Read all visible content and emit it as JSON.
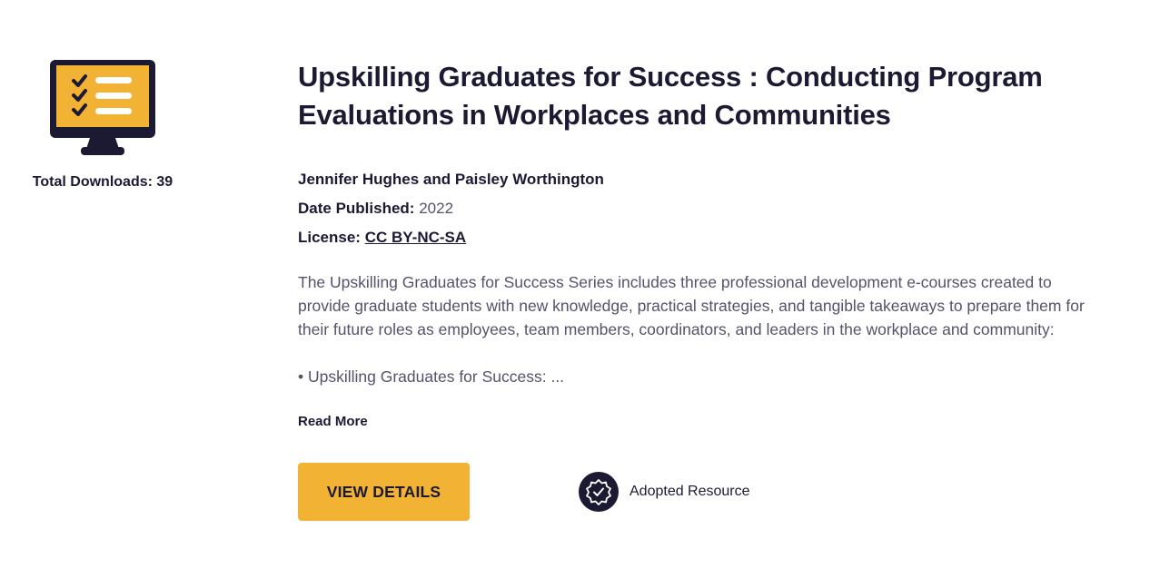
{
  "sidebar": {
    "icon": "monitor-checklist-icon",
    "downloads_label": "Total Downloads: 39"
  },
  "resource": {
    "title": "Upskilling Graduates for Success : Conducting Program Evaluations in Workplaces and Communities",
    "authors": "Jennifer Hughes and Paisley Worthington",
    "date_label": "Date Published:",
    "date_value": "2022",
    "license_label": "License:",
    "license_value": "CC BY-NC-SA",
    "description": "The Upskilling Graduates for Success Series includes three professional development e-courses created to provide graduate students with new knowledge, practical strategies, and tangible takeaways to prepare them for their future roles as employees, team members, coordinators, and leaders in the workplace and community:",
    "bullet": "• Upskilling Graduates for Success: ...",
    "read_more": "Read More"
  },
  "actions": {
    "view_details": "VIEW DETAILS",
    "adopted_label": "Adopted Resource",
    "adopted_icon": "badge-check-icon"
  },
  "colors": {
    "accent": "#f2b233",
    "dark": "#1c1a33",
    "body_text": "#55536a"
  }
}
